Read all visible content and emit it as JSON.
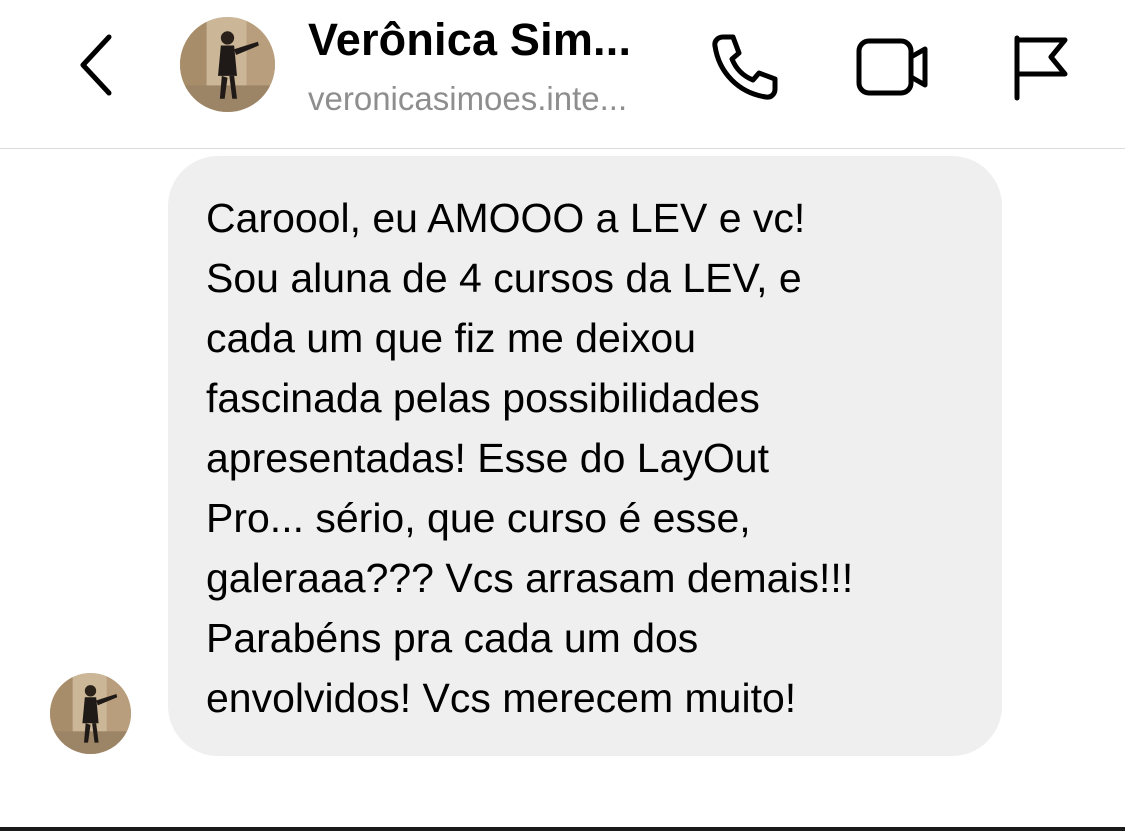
{
  "header": {
    "contact_name": "Verônica Sim...",
    "contact_username": "veronicasimoes.inte...",
    "icons": {
      "back": "chevron-left-icon",
      "call": "phone-icon",
      "video": "video-camera-icon",
      "report": "flag-icon"
    }
  },
  "conversation": {
    "messages": [
      {
        "sender": "Verônica Sim...",
        "lines": [
          "Caroool, eu AMOOO a LEV e vc!",
          "Sou aluna de 4 cursos da LEV, e",
          "cada um que fiz me deixou",
          "fascinada pelas possibilidades",
          "apresentadas! Esse do LayOut",
          "Pro... sério, que curso é esse,",
          "galeraaa??? Vcs arrasam demais!!!",
          "Parabéns pra cada um dos",
          "envolvidos! Vcs merecem muito!"
        ]
      }
    ]
  },
  "colors": {
    "bubble_background": "#efefef",
    "secondary_text": "#8e8e8e",
    "divider": "#dbdbdb"
  }
}
